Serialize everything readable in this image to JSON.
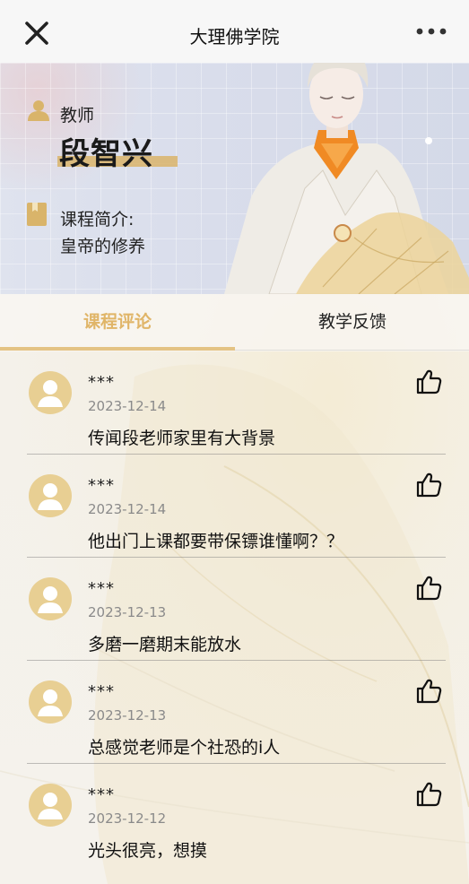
{
  "header": {
    "title": "大理佛学院"
  },
  "teacher": {
    "role": "教师",
    "name": "段智兴",
    "course_label": "课程简介:",
    "course_name": "皇帝的修养"
  },
  "tabs": [
    {
      "label": "课程评论",
      "active": true
    },
    {
      "label": "教学反馈",
      "active": false
    }
  ],
  "comments": [
    {
      "author": "***",
      "date": "2023-12-14",
      "text": "传闻段老师家里有大背景"
    },
    {
      "author": "***",
      "date": "2023-12-14",
      "text": "他出门上课都要带保镖谁懂啊？？"
    },
    {
      "author": "***",
      "date": "2023-12-13",
      "text": "多磨一磨期末能放水"
    },
    {
      "author": "***",
      "date": "2023-12-13",
      "text": "总感觉老师是个社恐的i人"
    },
    {
      "author": "***",
      "date": "2023-12-12",
      "text": "光头很亮，想摸"
    }
  ],
  "colors": {
    "accent": "#e0b568",
    "avatar_bg": "#e8cf93",
    "name_underline": "#d9b46a"
  },
  "icons": {
    "close": "close-icon",
    "more": "more-icon",
    "teacher": "person-icon",
    "course": "book-icon",
    "avatar": "avatar-icon",
    "like": "thumbs-up-icon"
  }
}
